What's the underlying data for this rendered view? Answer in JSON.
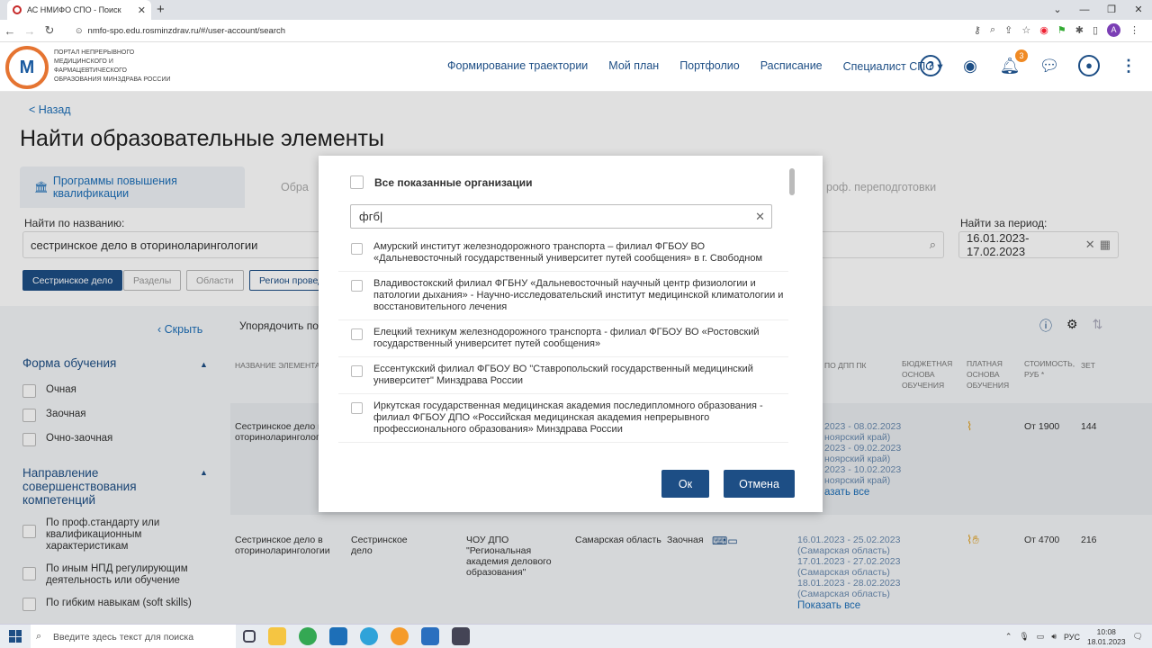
{
  "browser": {
    "tab_title": "АС НМИФО СПО - Поиск",
    "url": "nmfo-spo.edu.rosminzdrav.ru/#/user-account/search",
    "profile_initial": "A"
  },
  "header": {
    "logo_text": "Портал непрерывного медицинского и фармацевтического образования Минздрава России",
    "nav": [
      "Формирование траектории",
      "Мой план",
      "Портфолио",
      "Расписание",
      "Специалист СПО ▾"
    ],
    "notif_count": "3"
  },
  "page": {
    "back": "< Назад",
    "title": "Найти образовательные элементы",
    "tab_programs": "Программы повышения квалификации",
    "tab_other": "Обра",
    "tab_retraining": "роф. переподготовки",
    "search_label": "Найти по названию:",
    "search_value": "сестринское дело в оториноларингологии",
    "period_label": "Найти за период:",
    "period_value": "16.01.2023-17.02.2023",
    "chips": [
      "Сестринское дело",
      "Разделы",
      "Области",
      "Регион провед"
    ],
    "hide": "Скрыть",
    "sort_label": "Упорядочить по:"
  },
  "filters": {
    "form_title": "Форма обучения",
    "forms": [
      "Очная",
      "Заочная",
      "Очно-заочная"
    ],
    "direction_title": "Направление совершенствования компетенций",
    "directions": [
      "По проф.стандарту или квалификационным характеристикам",
      "По иным НПД регулирующим деятельность или обучение",
      "По гибким навыкам (soft skills)"
    ]
  },
  "table": {
    "headers": {
      "name": "Название элемента",
      "dpp": "по ДПП ПК",
      "budget": "Бюджетная основа обучения",
      "paid": "Платная основа обучения",
      "cost": "Стоимость, руб *",
      "zet": "ЗЕТ"
    },
    "row1": {
      "name": "Сестринское дело в оториноларингологии",
      "dates": [
        "2023 - 08.02.2023",
        "ноярский край)",
        "2023 - 09.02.2023",
        "ноярский край)",
        "2023 - 10.02.2023",
        "ноярский край)"
      ],
      "show_all": "азать все",
      "cost": "От 1900",
      "zet": "144"
    },
    "row2": {
      "name": "Сестринское дело в оториноларингологии",
      "spec": "Сестринское дело",
      "org": "ЧОУ ДПО \"Региональная академия делового образования\"",
      "region": "Самарская область",
      "form": "Заочная",
      "dates": [
        "16.01.2023 - 25.02.2023",
        "(Самарская область)",
        "17.01.2023 - 27.02.2023",
        "(Самарская область)",
        "18.01.2023 - 28.02.2023",
        "(Самарская область)"
      ],
      "show_all": "Показать все",
      "cost": "От 4700",
      "zet": "216"
    }
  },
  "modal": {
    "all_label": "Все показанные организации",
    "search_value": "фгб",
    "orgs": [
      "Амурский институт железнодорожного транспорта – филиал ФГБОУ ВО «Дальневосточный государственный университет путей сообщения» в г. Свободном",
      "Владивостокский филиал ФГБНУ «Дальневосточный научный центр физиологии и патологии дыхания» - Научно-исследовательский институт медицинской климатологии и восстановительного лечения",
      "Елецкий техникум железнодорожного транспорта - филиал ФГБОУ ВО «Ростовский государственный университет путей сообщения»",
      "Ессентукский филиал ФГБОУ ВО \"Ставропольский государственный медицинский университет\" Минздрава России",
      "Иркутская государственная медицинская академия последипломного образования - филиал ФГБОУ ДПО «Российская медицинская академия непрерывного профессионального образования» Минздрава России"
    ],
    "ok": "Ок",
    "cancel": "Отмена"
  },
  "taskbar": {
    "search_placeholder": "Введите здесь текст для поиска",
    "lang": "РУС",
    "time": "10:08",
    "date": "18.01.2023"
  }
}
